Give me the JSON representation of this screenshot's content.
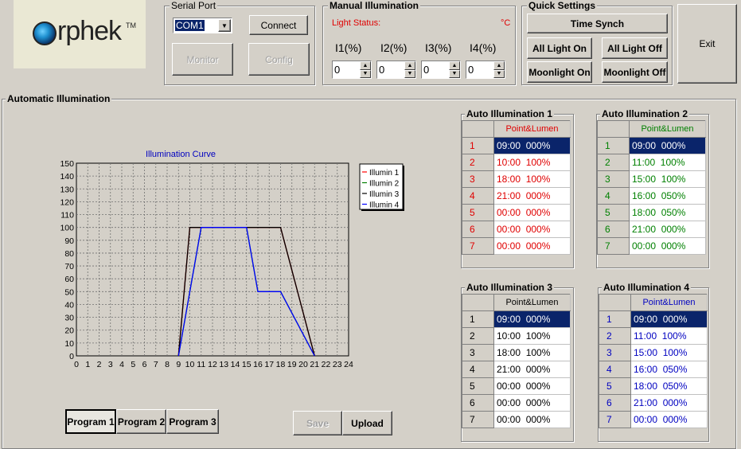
{
  "logo": {
    "brand": "rphek",
    "tm": "TM"
  },
  "serial": {
    "title": "Serial Port",
    "port": "COM1",
    "connect": "Connect",
    "monitor": "Monitor",
    "config": "Config"
  },
  "manual": {
    "title": "Manual Illumination",
    "light_status": "Light Status:",
    "unit": "°C",
    "channels": [
      {
        "label": "I1(%)",
        "value": "0"
      },
      {
        "label": "I2(%)",
        "value": "0"
      },
      {
        "label": "I3(%)",
        "value": "0"
      },
      {
        "label": "I4(%)",
        "value": "0"
      }
    ]
  },
  "quick": {
    "title": "Quick Settings",
    "time_synch": "Time Synch",
    "all_on": "All Light On",
    "all_off": "All Light Off",
    "moon_on": "Moonlight On",
    "moon_off": "Moonlight Off"
  },
  "exit": "Exit",
  "auto": {
    "title": "Automatic Illumination"
  },
  "chart_data": {
    "type": "line",
    "title": "Illumination Curve",
    "xlabel": "",
    "ylabel": "",
    "xlim": [
      0,
      24
    ],
    "ylim": [
      0,
      150
    ],
    "xticks": [
      0,
      1,
      2,
      3,
      4,
      5,
      6,
      7,
      8,
      9,
      10,
      11,
      12,
      13,
      14,
      15,
      16,
      17,
      18,
      19,
      20,
      21,
      22,
      23,
      24
    ],
    "yticks": [
      0,
      10,
      20,
      30,
      40,
      50,
      60,
      70,
      80,
      90,
      100,
      110,
      120,
      130,
      140,
      150
    ],
    "grid": true,
    "legend_position": "top-right",
    "series": [
      {
        "name": "Illumin 1",
        "color": "#ff0000",
        "x": [
          9,
          10,
          18,
          21
        ],
        "y": [
          0,
          100,
          100,
          0
        ]
      },
      {
        "name": "Illumin 2",
        "color": "#008000",
        "x": [
          9,
          11,
          15,
          16,
          18,
          21
        ],
        "y": [
          0,
          100,
          100,
          50,
          50,
          0
        ]
      },
      {
        "name": "Illumin 3",
        "color": "#000000",
        "x": [
          9,
          10,
          18,
          21
        ],
        "y": [
          0,
          100,
          100,
          0
        ]
      },
      {
        "name": "Illumin 4",
        "color": "#0000ff",
        "x": [
          9,
          11,
          15,
          16,
          18,
          21
        ],
        "y": [
          0,
          100,
          100,
          50,
          50,
          0
        ]
      }
    ]
  },
  "programs": [
    "Program 1",
    "Program 2",
    "Program 3"
  ],
  "save": "Save",
  "upload": "Upload",
  "tables": [
    {
      "title": "Auto Illumination 1",
      "header": "Point&Lumen",
      "color": "#e00000",
      "rows": [
        "09:00  000%",
        "10:00  100%",
        "18:00  100%",
        "21:00  000%",
        "00:00  000%",
        "00:00  000%",
        "00:00  000%"
      ]
    },
    {
      "title": "Auto Illumination 2",
      "header": "Point&Lumen",
      "color": "#008000",
      "rows": [
        "09:00  000%",
        "11:00  100%",
        "15:00  100%",
        "16:00  050%",
        "18:00  050%",
        "21:00  000%",
        "00:00  000%"
      ]
    },
    {
      "title": "Auto Illumination 3",
      "header": "Point&Lumen",
      "color": "#000000",
      "rows": [
        "09:00  000%",
        "10:00  100%",
        "18:00  100%",
        "21:00  000%",
        "00:00  000%",
        "00:00  000%",
        "00:00  000%"
      ]
    },
    {
      "title": "Auto Illumination 4",
      "header": "Point&Lumen",
      "color": "#0000c0",
      "rows": [
        "09:00  000%",
        "11:00  100%",
        "15:00  100%",
        "16:00  050%",
        "18:00  050%",
        "21:00  000%",
        "00:00  000%"
      ]
    }
  ]
}
